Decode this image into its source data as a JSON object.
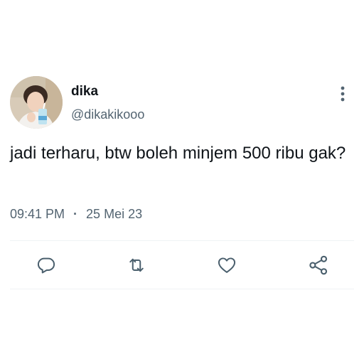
{
  "tweet": {
    "display_name": "dika",
    "handle": "@dikakikooo",
    "text": "jadi terharu, btw boleh minjem 500 ribu gak?",
    "time": "09:41 PM",
    "separator": "·",
    "date": "25 Mei 23"
  },
  "icons": {
    "more": "more-vertical-icon",
    "reply": "reply-icon",
    "retweet": "retweet-icon",
    "like": "heart-icon",
    "share": "share-icon"
  },
  "colors": {
    "text": "#0f1419",
    "secondary": "#536471",
    "icon": "#4a5f6d",
    "divider": "#eff3f4"
  }
}
